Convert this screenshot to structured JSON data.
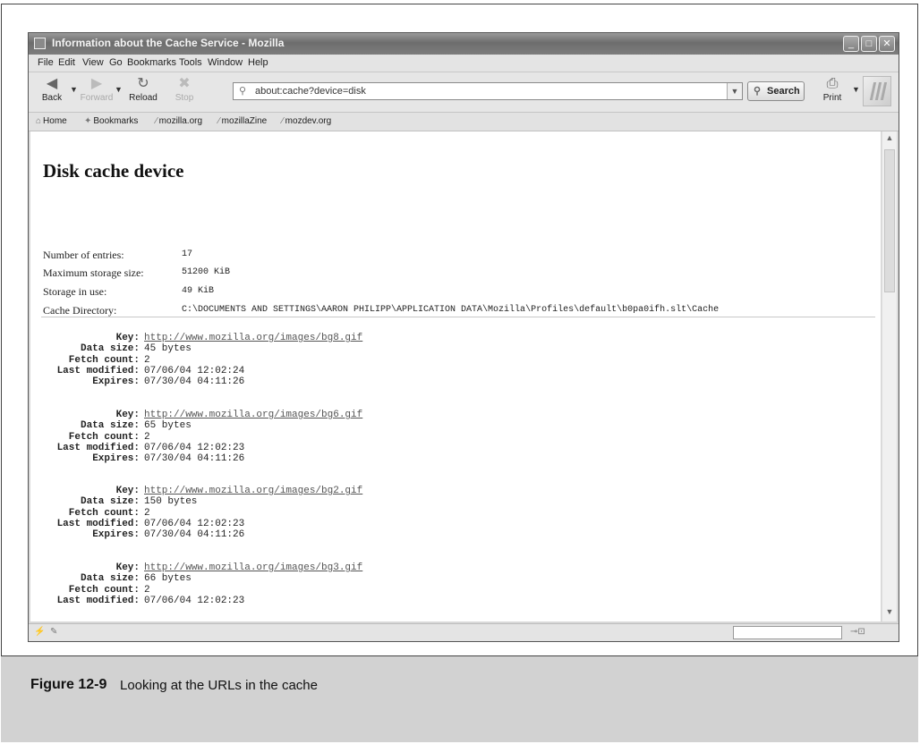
{
  "window": {
    "title": "Information about the Cache Service - Mozilla"
  },
  "menu": [
    "File",
    "Edit",
    "View",
    "Go",
    "Bookmarks",
    "Tools",
    "Window",
    "Help"
  ],
  "nav": {
    "back": "Back",
    "forward": "Forward",
    "reload": "Reload",
    "stop": "Stop",
    "search": "Search",
    "print": "Print"
  },
  "address": {
    "url": "about:cache?device=disk"
  },
  "bookmarks": [
    "Home",
    "Bookmarks",
    "mozilla.org",
    "mozillaZine",
    "mozdev.org"
  ],
  "page": {
    "title": "Disk cache device",
    "info": [
      {
        "label": "Number of entries:",
        "value": "17"
      },
      {
        "label": "Maximum storage size:",
        "value": "51200 KiB"
      },
      {
        "label": "Storage in use:",
        "value": "49 KiB"
      },
      {
        "label": "Cache Directory:",
        "value": "C:\\DOCUMENTS AND SETTINGS\\AARON PHILIPP\\APPLICATION DATA\\Mozilla\\Profiles\\default\\b0pa0ifh.slt\\Cache"
      }
    ],
    "field_labels": {
      "key": "Key:",
      "data_size": "Data size:",
      "fetch_count": "Fetch count:",
      "last_modified": "Last modified:",
      "expires": "Expires:"
    },
    "entries": [
      {
        "key": "http://www.mozilla.org/images/bg8.gif",
        "data_size": "45 bytes",
        "fetch_count": "2",
        "last_modified": "07/06/04 12:02:24",
        "expires": "07/30/04 04:11:26"
      },
      {
        "key": "http://www.mozilla.org/images/bg6.gif",
        "data_size": "65 bytes",
        "fetch_count": "2",
        "last_modified": "07/06/04 12:02:23",
        "expires": "07/30/04 04:11:26"
      },
      {
        "key": "http://www.mozilla.org/images/bg2.gif",
        "data_size": "150 bytes",
        "fetch_count": "2",
        "last_modified": "07/06/04 12:02:23",
        "expires": "07/30/04 04:11:26"
      },
      {
        "key": "http://www.mozilla.org/images/bg3.gif",
        "data_size": "66 bytes",
        "fetch_count": "2",
        "last_modified": "07/06/04 12:02:23"
      }
    ]
  },
  "caption": {
    "label": "Figure 12-9",
    "text": "Looking at the URLs in the cache"
  }
}
